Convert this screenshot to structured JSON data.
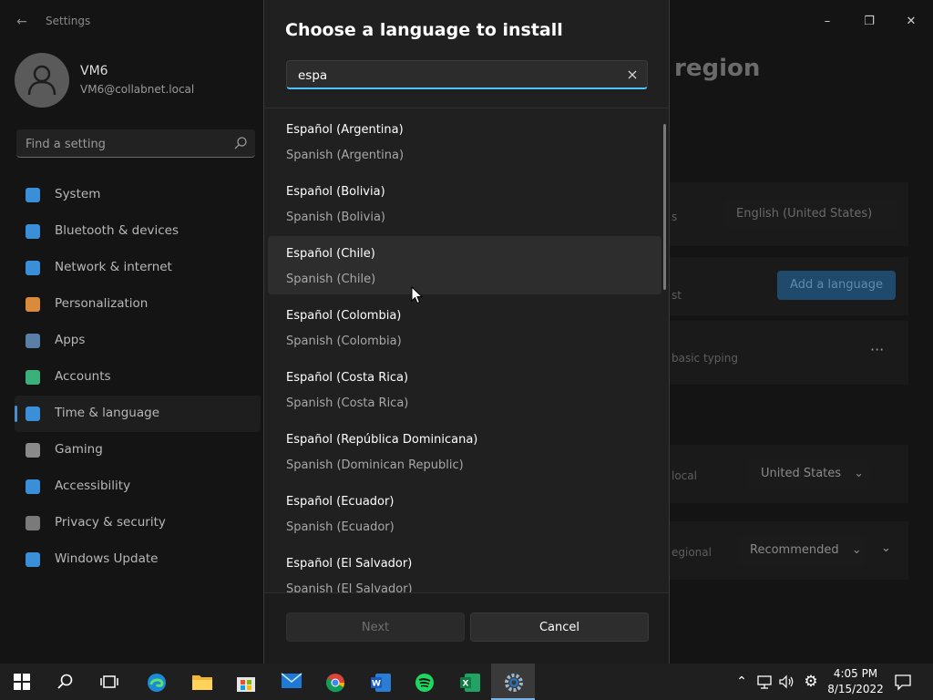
{
  "window": {
    "app_title": "Settings",
    "content_title_partial": "region",
    "controls": {
      "minimize": "–",
      "maximize": "❐",
      "close": "✕"
    }
  },
  "user": {
    "name": "VM6",
    "email": "VM6@collabnet.local"
  },
  "sidebar": {
    "search_placeholder": "Find a setting",
    "items": [
      {
        "label": "System",
        "icon": "monitor-icon",
        "color": "#3b8fd9"
      },
      {
        "label": "Bluetooth & devices",
        "icon": "bluetooth-icon",
        "color": "#3b8fd9"
      },
      {
        "label": "Network & internet",
        "icon": "wifi-icon",
        "color": "#3b8fd9"
      },
      {
        "label": "Personalization",
        "icon": "brush-icon",
        "color": "#d98a3b"
      },
      {
        "label": "Apps",
        "icon": "apps-icon",
        "color": "#5a7fa6"
      },
      {
        "label": "Accounts",
        "icon": "person-icon",
        "color": "#3bb07a"
      },
      {
        "label": "Time & language",
        "icon": "clock-globe-icon",
        "color": "#3b8fd9",
        "active": true
      },
      {
        "label": "Gaming",
        "icon": "gamepad-icon",
        "color": "#8a8a8a"
      },
      {
        "label": "Accessibility",
        "icon": "accessibility-icon",
        "color": "#3b8fd9"
      },
      {
        "label": "Privacy & security",
        "icon": "shield-icon",
        "color": "#7a7a7a"
      },
      {
        "label": "Windows Update",
        "icon": "update-icon",
        "color": "#3b8fd9"
      }
    ]
  },
  "background_content": {
    "preferred_dropdown": "English (United States)",
    "add_language_button": "Add a language",
    "row_text_1": "s",
    "row_text_2": "st",
    "row_text_3": "basic typing",
    "row_text_4": "local",
    "country_dropdown": "United States",
    "row_text_5": "egional",
    "format_dropdown": "Recommended",
    "more": "···"
  },
  "dialog": {
    "title": "Choose a language to install",
    "search_value": "espa",
    "languages": [
      {
        "native": "Español (Argentina)",
        "english": "Spanish (Argentina)"
      },
      {
        "native": "Español (Bolivia)",
        "english": "Spanish (Bolivia)"
      },
      {
        "native": "Español (Chile)",
        "english": "Spanish (Chile)",
        "hover": true
      },
      {
        "native": "Español (Colombia)",
        "english": "Spanish (Colombia)"
      },
      {
        "native": "Español (Costa Rica)",
        "english": "Spanish (Costa Rica)"
      },
      {
        "native": "Español (República Dominicana)",
        "english": "Spanish (Dominican Republic)"
      },
      {
        "native": "Español (Ecuador)",
        "english": "Spanish (Ecuador)"
      },
      {
        "native": "Español (El Salvador)",
        "english": "Spanish (El Salvador)"
      }
    ],
    "next_label": "Next",
    "cancel_label": "Cancel"
  },
  "taskbar": {
    "apps": [
      "start-icon",
      "search-icon",
      "task-view-icon",
      "edge-icon",
      "file-explorer-icon",
      "store-icon",
      "mail-icon",
      "chrome-icon",
      "word-icon",
      "spotify-icon",
      "excel-icon",
      "settings-icon"
    ],
    "time": "4:05 PM",
    "date": "8/15/2022"
  },
  "colors": {
    "accent": "#4cc2ff",
    "dialog_bg": "#202020",
    "taskbar_bg": "#1f1f1f"
  }
}
